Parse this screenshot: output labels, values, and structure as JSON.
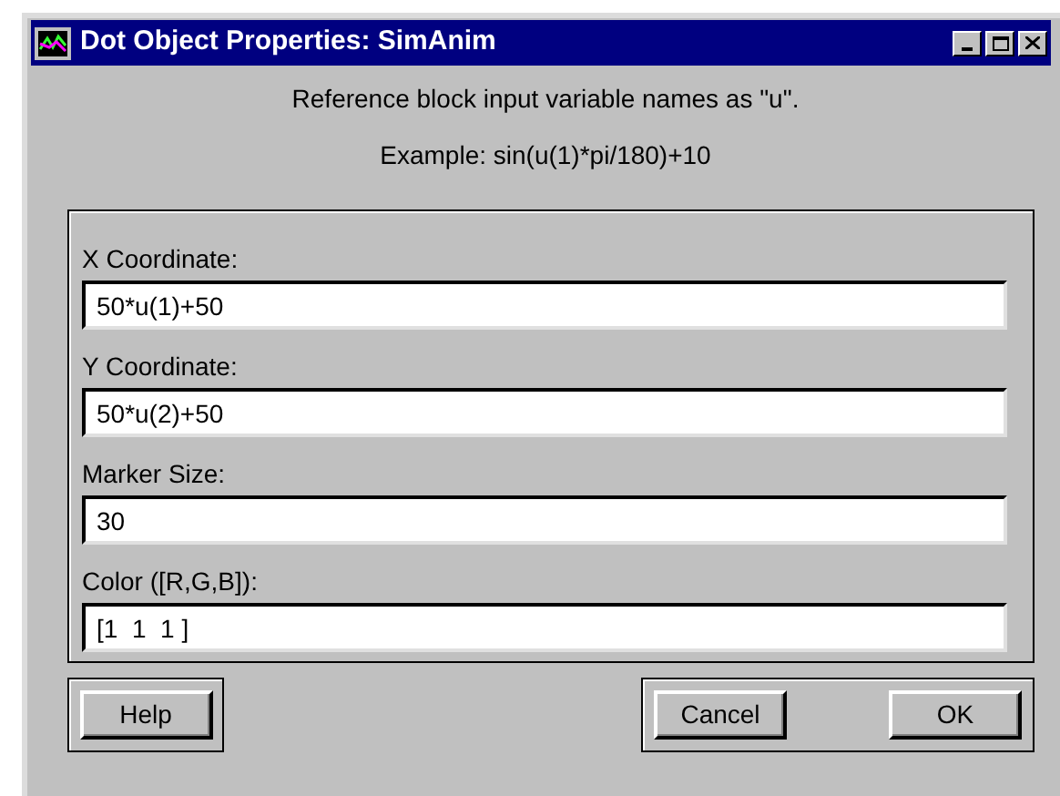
{
  "window": {
    "title": "Dot Object Properties: SimAnim"
  },
  "instructions": [
    "Reference block input variable names as \"u\".",
    "Example: sin(u(1)*pi/180)+10"
  ],
  "fields": [
    {
      "label": "X Coordinate:",
      "value": "50*u(1)+50"
    },
    {
      "label": "Y Coordinate:",
      "value": "50*u(2)+50"
    },
    {
      "label": "Marker Size:",
      "value": "30"
    },
    {
      "label": "Color ([R,G,B]):",
      "value": "[1  1  1 ]"
    }
  ],
  "buttons": {
    "help": "Help",
    "cancel": "Cancel",
    "ok": "OK"
  }
}
